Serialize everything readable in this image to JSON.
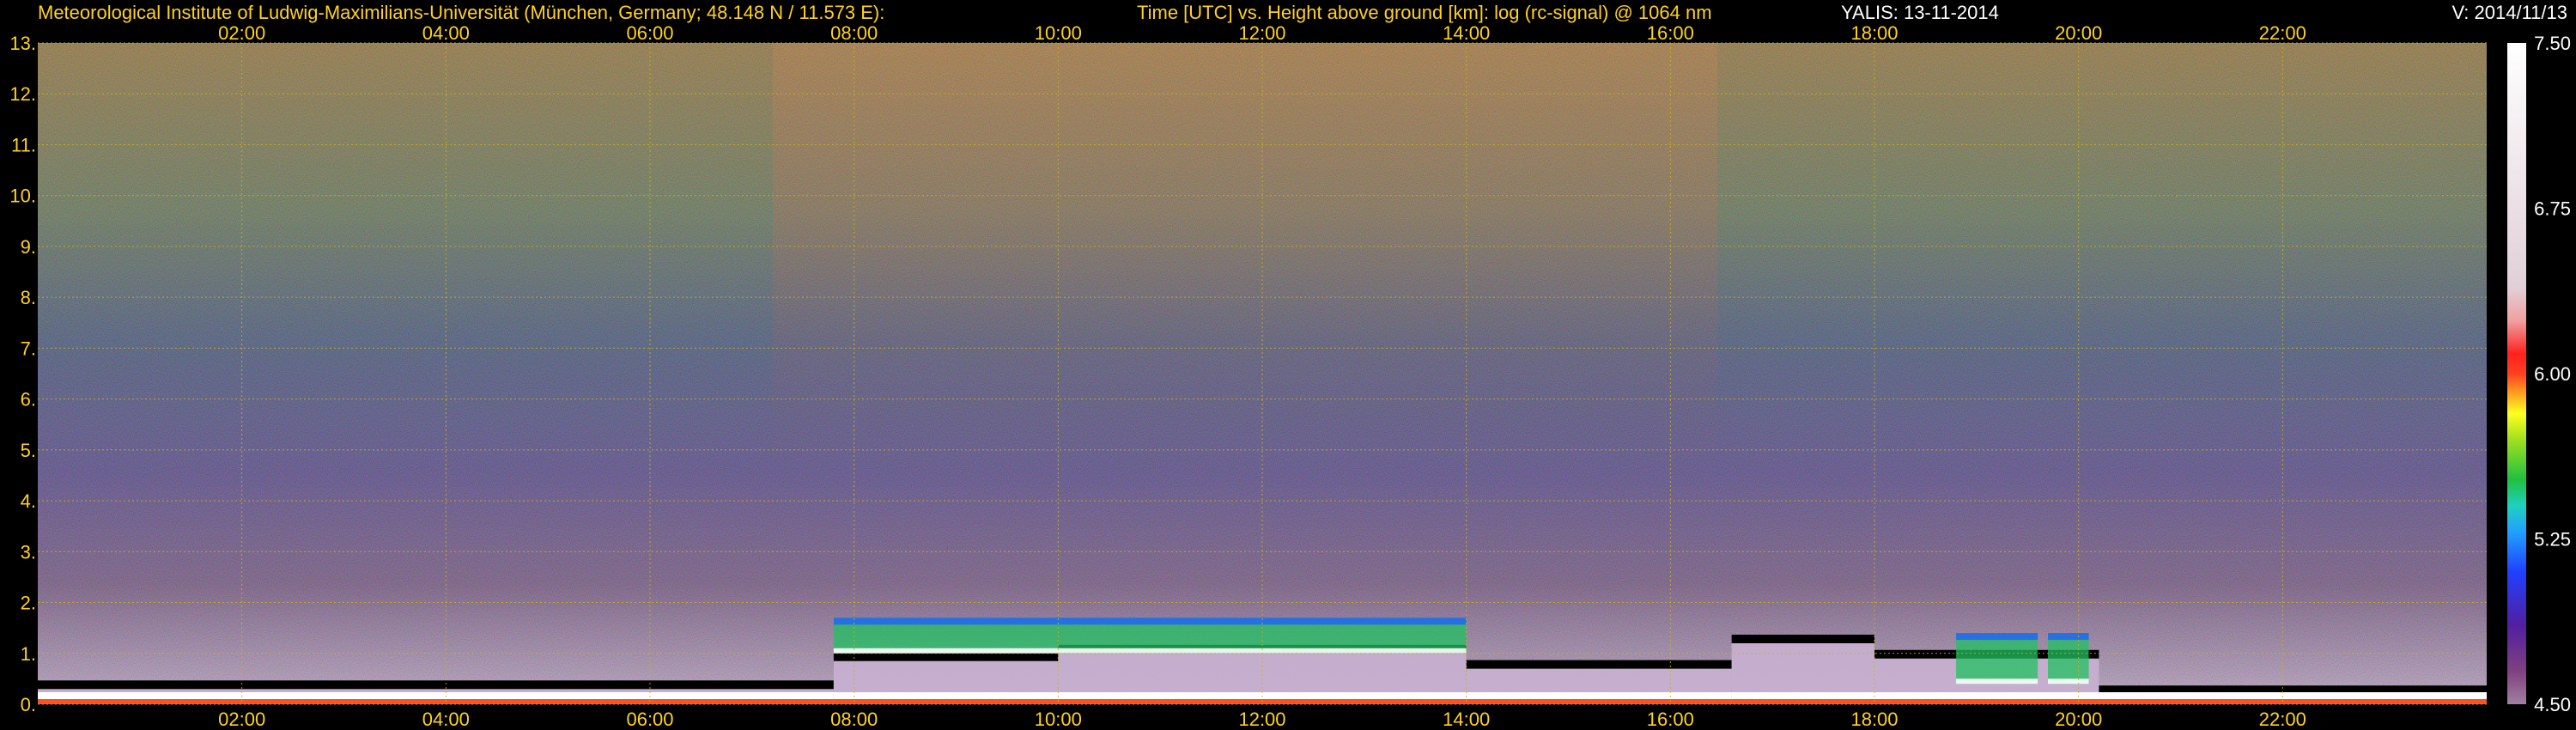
{
  "header": {
    "institute": "Meteorological Institute of Ludwig-Maximilians-Universität (München, Germany; 48.148 N / 11.573 E):",
    "description": "Time [UTC] vs. Height above ground [km]: log (rc-signal) @ 1064 nm",
    "instrument": "YALIS: 13-11-2014",
    "version": "V: 2014/11/13"
  },
  "chart_data": {
    "type": "heatmap",
    "title": "Time [UTC] vs. Height above ground [km]: log (rc-signal) @ 1064 nm",
    "x_ticks": [
      "02:00",
      "04:00",
      "06:00",
      "08:00",
      "10:00",
      "12:00",
      "14:00",
      "16:00",
      "18:00",
      "20:00",
      "22:00"
    ],
    "x_tick_hours": [
      2,
      4,
      6,
      8,
      10,
      12,
      14,
      16,
      18,
      20,
      22
    ],
    "xlim_hours": [
      0,
      24
    ],
    "y_ticks": [
      "0.",
      "1.",
      "2.",
      "3.",
      "4.",
      "5.",
      "6.",
      "7.",
      "8.",
      "9.",
      "10.",
      "11.",
      "12.",
      "13."
    ],
    "y_tick_values": [
      0,
      1,
      2,
      3,
      4,
      5,
      6,
      7,
      8,
      9,
      10,
      11,
      12,
      13
    ],
    "ylim_km": [
      0,
      13
    ],
    "grid": true,
    "colorbar": {
      "ticks": [
        "7.50",
        "6.75",
        "6.00",
        "5.25",
        "4.50"
      ],
      "tick_values": [
        7.5,
        6.75,
        6.0,
        5.25,
        4.5
      ],
      "range": [
        4.5,
        7.5
      ]
    },
    "features": {
      "boundary_layer_top_km": [
        {
          "hour_start": 0.0,
          "hour_end": 7.8,
          "height": 0.4
        },
        {
          "hour_start": 7.8,
          "hour_end": 10.0,
          "height": 0.95
        },
        {
          "hour_start": 10.0,
          "hour_end": 14.0,
          "height": 1.1
        },
        {
          "hour_start": 14.0,
          "hour_end": 16.6,
          "height": 0.8
        },
        {
          "hour_start": 16.6,
          "hour_end": 18.0,
          "height": 1.3
        },
        {
          "hour_start": 18.0,
          "hour_end": 20.2,
          "height": 1.0
        },
        {
          "hour_start": 20.2,
          "hour_end": 24.0,
          "height": 0.3
        }
      ],
      "cloud_layers_km": [
        {
          "hour_start": 7.8,
          "hour_end": 14.0,
          "base": 1.0,
          "top": 1.7
        },
        {
          "hour_start": 18.8,
          "hour_end": 19.6,
          "base": 0.4,
          "top": 1.4
        },
        {
          "hour_start": 19.7,
          "hour_end": 20.1,
          "base": 0.4,
          "top": 1.4
        }
      ]
    }
  }
}
